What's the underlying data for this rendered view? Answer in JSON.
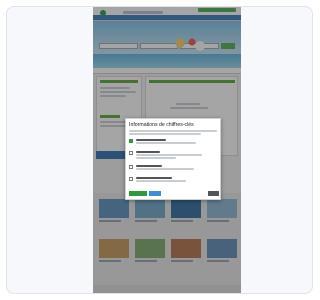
{
  "modal": {
    "title": "Informations de chiffres-clés",
    "buttons": [
      {
        "name": "accept-all-button",
        "color": "#2e9a3a"
      },
      {
        "name": "save-choice-button",
        "color": "#3c8fd4"
      },
      {
        "name": "reject-button",
        "color": "#555555"
      }
    ]
  },
  "thumbnails": [
    {
      "color": "#5a8fc0"
    },
    {
      "color": "#6fa6c9"
    },
    {
      "color": "#2d6b9e"
    },
    {
      "color": "#8bb5d4"
    },
    {
      "color": "#c49a5a"
    },
    {
      "color": "#7aa96a"
    },
    {
      "color": "#b5734a"
    },
    {
      "color": "#5d8cb6"
    }
  ],
  "colors": {
    "brand_green": "#2e9a3a",
    "brand_blue": "#1f6fb8",
    "overlay": "rgba(40,40,40,0.42)"
  }
}
